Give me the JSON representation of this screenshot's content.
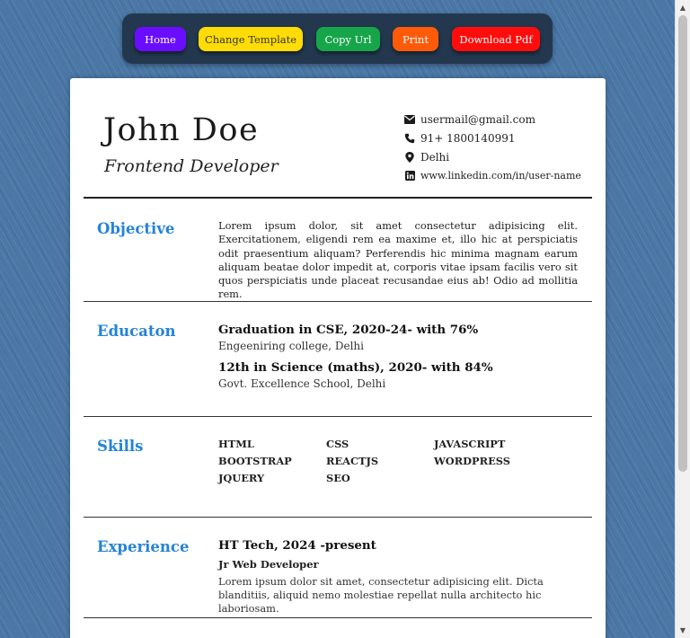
{
  "toolbar": {
    "home": "Home",
    "change_template": "Change Template",
    "copy_url": "Copy Url",
    "print": "Print",
    "download_pdf": "Download Pdf"
  },
  "header": {
    "name": "John Doe",
    "role": "Frontend Developer"
  },
  "contact": {
    "email": "usermail@gmail.com",
    "phone": "91+ 1800140991",
    "location": "Delhi",
    "linkedin": "www.linkedin.com/in/user-name"
  },
  "objective": {
    "title": "Objective",
    "text": "Lorem ipsum dolor, sit amet consectetur adipisicing elit. Exercitationem, eligendi rem ea maxime et, illo hic at perspiciatis odit praesentium aliquam? Perferendis hic minima magnam earum aliquam beatae dolor impedit at, corporis vitae ipsam facilis vero sit quos perspiciatis unde placeat recusandae eius ab! Odio ad mollitia rem."
  },
  "education": {
    "title": "Educaton",
    "items": [
      {
        "degree": "Graduation in CSE, 2020-24- with 76%",
        "school": "Engeeniring college, Delhi"
      },
      {
        "degree": "12th in Science (maths), 2020- with 84%",
        "school": "Govt. Excellence School, Delhi"
      }
    ]
  },
  "skills": {
    "title": "Skills",
    "items": [
      "HTML",
      "CSS",
      "JAVASCRIPT",
      "BOOTSTRAP",
      "REACTJS",
      "WORDPRESS",
      "JQUERY",
      "SEO"
    ]
  },
  "experience": {
    "title": "Experience",
    "company": "HT Tech, 2024 -present",
    "position": "Jr Web Developer",
    "description": "Lorem ipsum dolor sit amet, consectetur adipisicing elit. Dicta blanditiis, aliquid nemo molestiae repellat nulla architecto hic laboriosam."
  },
  "colors": {
    "accent": "#2583d6",
    "background": "#4a77a6",
    "toolbar": "#23384f"
  }
}
